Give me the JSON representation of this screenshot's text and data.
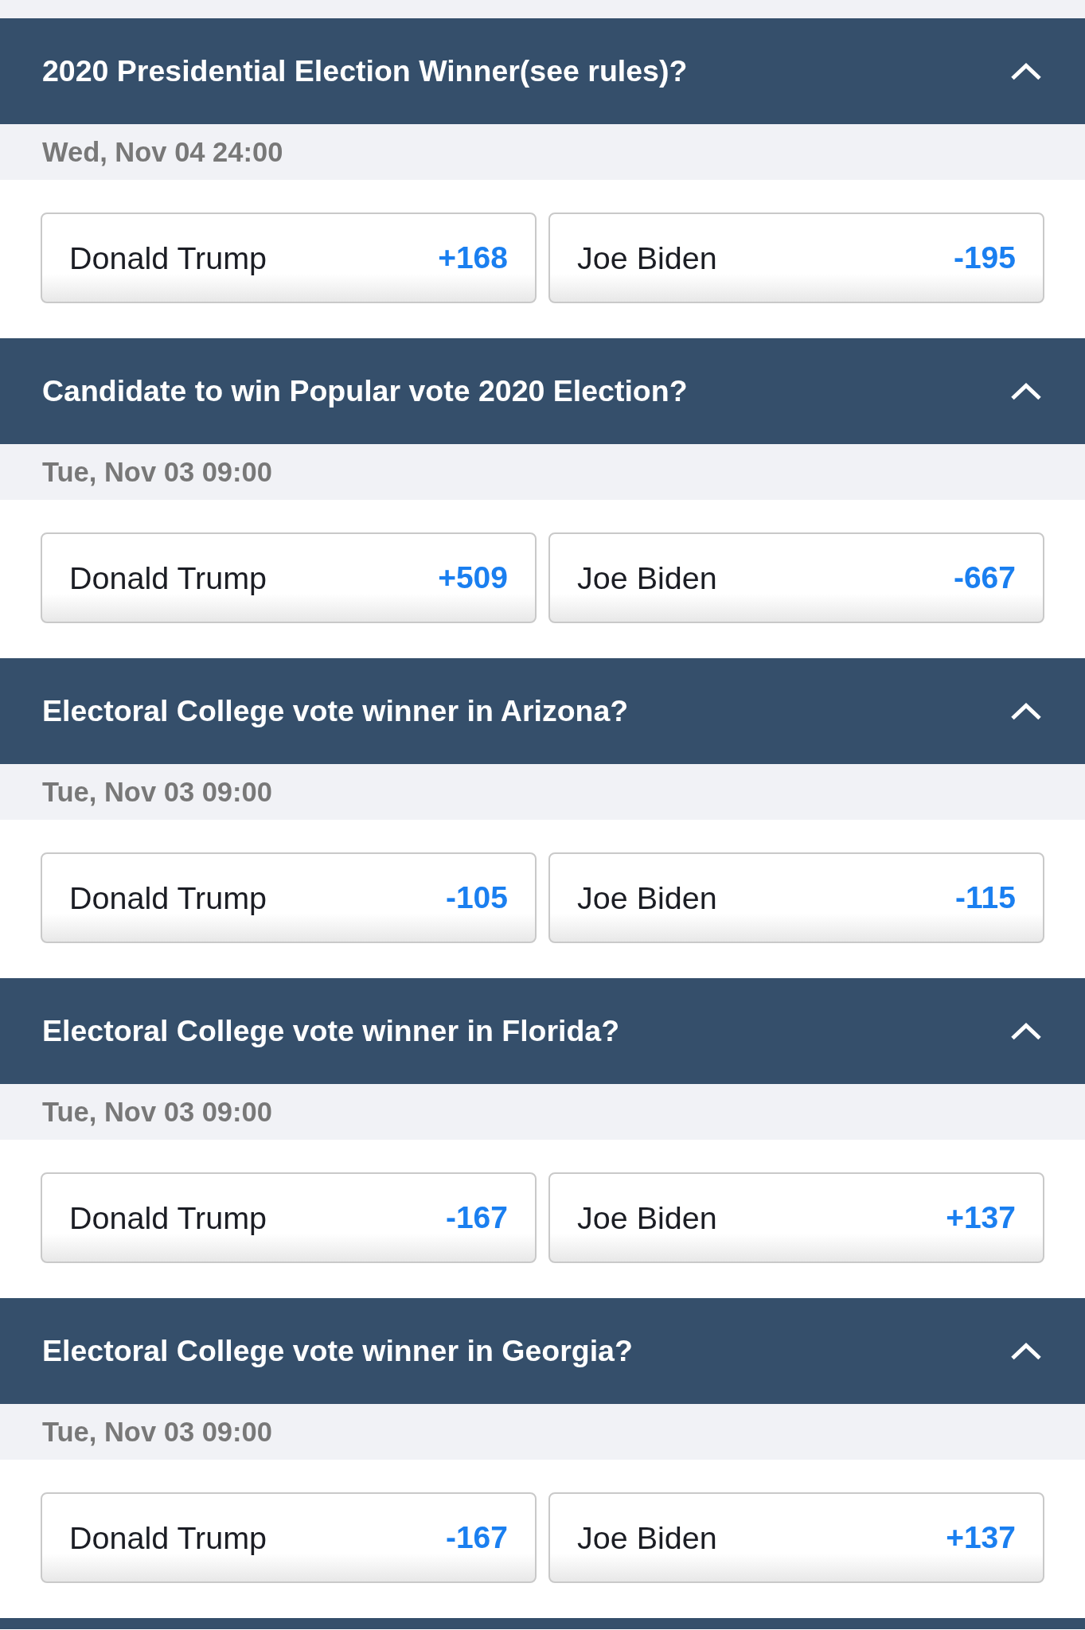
{
  "markets": [
    {
      "title": "2020 Presidential Election Winner(see rules)?",
      "expanded": true,
      "date": "Wed, Nov 04 24:00",
      "selections": [
        {
          "name": "Donald Trump",
          "odds": "+168"
        },
        {
          "name": "Joe Biden",
          "odds": "-195"
        }
      ]
    },
    {
      "title": "Candidate to win Popular vote 2020 Election?",
      "expanded": true,
      "date": "Tue, Nov 03 09:00",
      "selections": [
        {
          "name": "Donald Trump",
          "odds": "+509"
        },
        {
          "name": "Joe Biden",
          "odds": "-667"
        }
      ]
    },
    {
      "title": "Electoral College vote winner in Arizona?",
      "expanded": true,
      "date": "Tue, Nov 03 09:00",
      "selections": [
        {
          "name": "Donald Trump",
          "odds": "-105"
        },
        {
          "name": "Joe Biden",
          "odds": "-115"
        }
      ]
    },
    {
      "title": "Electoral College vote winner in Florida?",
      "expanded": true,
      "date": "Tue, Nov 03 09:00",
      "selections": [
        {
          "name": "Donald Trump",
          "odds": "-167"
        },
        {
          "name": "Joe Biden",
          "odds": "+137"
        }
      ]
    },
    {
      "title": "Electoral College vote winner in Georgia?",
      "expanded": true,
      "date": "Tue, Nov 03 09:00",
      "selections": [
        {
          "name": "Donald Trump",
          "odds": "-167"
        },
        {
          "name": "Joe Biden",
          "odds": "+137"
        }
      ]
    }
  ]
}
